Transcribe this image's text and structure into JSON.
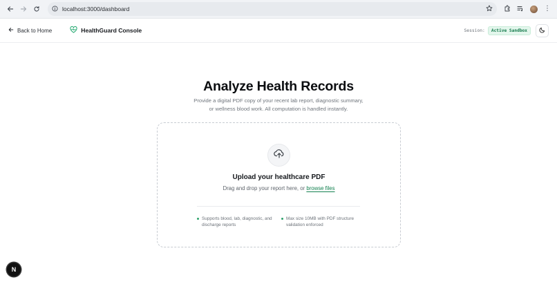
{
  "browser": {
    "url": "localhost:3000/dashboard"
  },
  "header": {
    "back_label": "Back to Home",
    "brand_name": "HealthGuard Console",
    "session_label": "Session:",
    "session_value": "Active Sandbox"
  },
  "main": {
    "title": "Analyze Health Records",
    "subtitle": "Provide a digital PDF copy of your recent lab report, diagnostic summary, or wellness blood work. All computation is handled instantly.",
    "dropzone": {
      "title": "Upload your healthcare PDF",
      "hint": "Drag and drop your report here, or",
      "browse_label": "browse files",
      "features": [
        "Supports blood, lab, diagnostic, and discharge reports",
        "Max size 10MB with PDF structure validation enforced"
      ]
    }
  },
  "dev_badge": {
    "letter": "N"
  },
  "colors": {
    "accent_green": "#12804f",
    "badge_bg": "#e3f6ec"
  },
  "icons": [
    "back-arrow-icon",
    "forward-arrow-icon",
    "reload-icon",
    "site-info-icon",
    "star-icon",
    "extensions-icon",
    "media-icon",
    "profile-avatar",
    "menu-icon",
    "arrow-left-icon",
    "heart-pulse-icon",
    "moon-icon",
    "cloud-upload-icon"
  ]
}
